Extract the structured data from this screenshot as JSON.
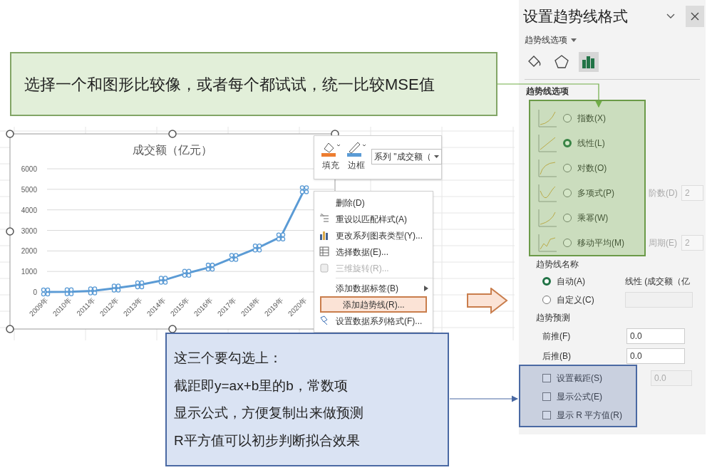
{
  "top_note": {
    "text": "选择一个和图形比较像，或者每个都试试，统一比较MSE值"
  },
  "chart": {
    "chart_data": {
      "type": "line",
      "title": "成交额（亿元）",
      "grid": true,
      "categories": [
        "2009年",
        "2010年",
        "2011年",
        "2012年",
        "2013年",
        "2014年",
        "2015年",
        "2016年",
        "2017年",
        "2018年",
        "2019年",
        "2020年"
      ],
      "series": [
        {
          "color": "#5b9bd5",
          "values": [
            0,
            10,
            50,
            190,
            350,
            570,
            910,
            1210,
            1680,
            2140,
            2680,
            4980
          ]
        }
      ],
      "ylim": [
        0,
        6000
      ],
      "yticks": [
        0,
        1000,
        2000,
        3000,
        4000,
        5000,
        6000
      ]
    }
  },
  "format_toolbar": {
    "buttons": [
      {
        "kind": "fill",
        "label": "填充"
      },
      {
        "kind": "border",
        "label": "边框"
      }
    ],
    "series_dropdown": "系列 \"成交额（"
  },
  "context_menu": {
    "items": [
      {
        "label": "删除(D)",
        "disabled": false,
        "highlighted": false,
        "submenu": false
      },
      {
        "label": "重设以匹配样式(A)",
        "disabled": false,
        "highlighted": false,
        "submenu": false
      },
      {
        "label": "更改系列图表类型(Y)...",
        "disabled": false,
        "highlighted": false,
        "submenu": false
      },
      {
        "label": "选择数据(E)...",
        "disabled": false,
        "highlighted": false,
        "submenu": false
      },
      {
        "label": "三维旋转(R)...",
        "disabled": true,
        "highlighted": false,
        "submenu": false
      },
      {
        "label": "添加数据标签(B)",
        "disabled": false,
        "highlighted": false,
        "submenu": true
      },
      {
        "label": "添加趋势线(R)...",
        "disabled": false,
        "highlighted": true,
        "submenu": false
      },
      {
        "label": "设置数据系列格式(F)...",
        "disabled": false,
        "highlighted": false,
        "submenu": false
      }
    ]
  },
  "bottom_note": {
    "lines": [
      "这三个要勾选上：",
      "截距即y=ax+b里的b，常数项",
      "显示公式，方便复制出来做预测",
      "R平方值可以初步判断拟合效果"
    ]
  },
  "pane": {
    "title": "设置趋势线格式",
    "options_dropdown": "趋势线选项",
    "tabs": [
      {
        "kind": "fill",
        "selected": false
      },
      {
        "kind": "effects",
        "selected": false
      },
      {
        "kind": "options",
        "selected": true
      }
    ],
    "section": "趋势线选项",
    "trend_types": [
      {
        "kind": "exponential",
        "label": "指数(X)",
        "selected": false
      },
      {
        "kind": "linear",
        "label": "线性(L)",
        "selected": true
      },
      {
        "kind": "logarithmic",
        "label": "对数(O)",
        "selected": false
      },
      {
        "kind": "polynomial",
        "label": "多项式(P)",
        "selected": false,
        "param_label": "阶数(D)",
        "param_value": "2"
      },
      {
        "kind": "power",
        "label": "乘幂(W)",
        "selected": false
      },
      {
        "kind": "moving_average",
        "label": "移动平均(M)",
        "selected": false,
        "param_label": "周期(E)",
        "param_value": "2"
      }
    ],
    "name_heading": "趋势线名称",
    "name_options": [
      {
        "label": "自动(A)",
        "selected": true,
        "value": "线性 (成交额（亿"
      },
      {
        "label": "自定义(C)",
        "selected": false
      }
    ],
    "forecast_heading": "趋势预测",
    "forecast": [
      {
        "label": "前推(F)",
        "value": "0.0"
      },
      {
        "label": "后推(B)",
        "value": "0.0"
      }
    ],
    "checkboxes": [
      {
        "label": "设置截距(S)",
        "checked": false,
        "placeholder": "0.0"
      },
      {
        "label": "显示公式(E)",
        "checked": false
      },
      {
        "label": "显示 R 平方值(R)",
        "checked": false
      }
    ]
  }
}
